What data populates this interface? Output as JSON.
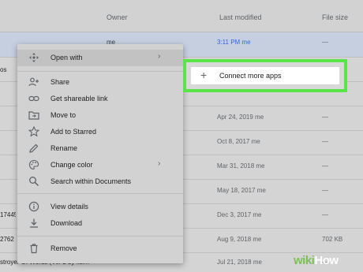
{
  "table": {
    "headers": {
      "owner": "Owner",
      "last_modified": "Last modified",
      "file_size": "File size"
    },
    "rows": [
      {
        "name": "",
        "owner": "me",
        "date": "3:11 PM  me",
        "size": "—",
        "selected": true,
        "date_blue": true
      },
      {
        "name": "os",
        "owner": "",
        "date": "",
        "size": ""
      },
      {
        "name": "",
        "owner": "",
        "date": "",
        "size": ""
      },
      {
        "name": "",
        "owner": "",
        "date": "",
        "size": "—"
      },
      {
        "name": "",
        "owner": "",
        "date": "Apr 24, 2019  me",
        "size": "—"
      },
      {
        "name": "",
        "owner": "",
        "date": "Oct 8, 2017  me",
        "size": "—"
      },
      {
        "name": "",
        "owner": "",
        "date": "Mar 31, 2018  me",
        "size": "—"
      },
      {
        "name": "",
        "owner": "",
        "date": "May 18, 2017  me",
        "size": "—"
      },
      {
        "name": "17445",
        "owner": "",
        "date": "Dec 3, 2017  me",
        "size": "—"
      },
      {
        "name": "2762",
        "owner": "",
        "date": "Aug 9, 2018  me",
        "size": "702 KB"
      },
      {
        "name": "stroyer Of Words (Ver 2 by fisi...",
        "owner": "",
        "date": "Jul 21, 2018  me",
        "size": "—"
      }
    ]
  },
  "context_menu": {
    "items": [
      {
        "label": "Open with",
        "icon": "open-with-icon",
        "has_submenu": true
      },
      {
        "label": "Share",
        "icon": "share-person-icon"
      },
      {
        "label": "Get shareable link",
        "icon": "link-icon"
      },
      {
        "label": "Move to",
        "icon": "move-to-folder-icon"
      },
      {
        "label": "Add to Starred",
        "icon": "star-icon"
      },
      {
        "label": "Rename",
        "icon": "pencil-icon"
      },
      {
        "label": "Change color",
        "icon": "palette-icon",
        "has_submenu": true
      },
      {
        "label": "Search within Documents",
        "icon": "search-icon"
      },
      {
        "label": "View details",
        "icon": "info-icon"
      },
      {
        "label": "Download",
        "icon": "download-icon"
      },
      {
        "label": "Remove",
        "icon": "trash-icon"
      }
    ]
  },
  "submenu": {
    "label": "Connect more apps",
    "icon": "plus-icon"
  },
  "watermark": {
    "wiki": "wiki",
    "how": "How"
  },
  "colors": {
    "highlight_border": "#5be34a",
    "selected_row": "#c6cfe0",
    "link_blue": "#3367d6"
  }
}
